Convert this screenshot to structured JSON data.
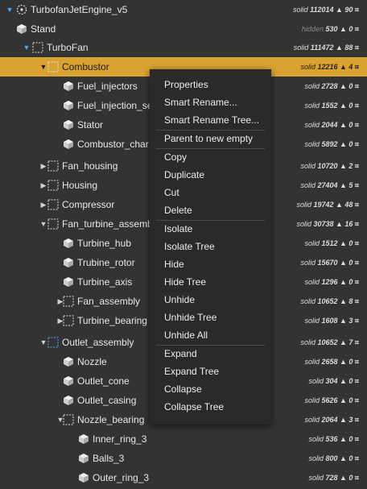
{
  "tree": {
    "rows": [
      {
        "label": "TurbofanJetEngine_v5",
        "icon": "root-icon",
        "toggle": "expanded-blue",
        "status": "solid",
        "count": "112014",
        "tri": "90",
        "selected": false
      },
      {
        "label": "Stand",
        "icon": "part-icon",
        "toggle": "",
        "status": "hidden",
        "count": "530",
        "tri": "0",
        "selected": false
      },
      {
        "label": "TurboFan",
        "icon": "group-icon",
        "toggle": "expanded-blue",
        "status": "solid",
        "count": "111472",
        "tri": "88",
        "selected": false
      },
      {
        "label": "Combustor",
        "icon": "group-icon",
        "toggle": "expanded",
        "status": "solid",
        "count": "12216",
        "tri": "4",
        "selected": true
      },
      {
        "label": "Fuel_injectors",
        "icon": "part-icon",
        "toggle": "",
        "status": "solid",
        "count": "2728",
        "tri": "0",
        "selected": false
      },
      {
        "label": "Fuel_injection_se",
        "icon": "part-icon",
        "toggle": "",
        "status": "solid",
        "count": "1552",
        "tri": "0",
        "selected": false
      },
      {
        "label": "Stator",
        "icon": "part-icon",
        "toggle": "",
        "status": "solid",
        "count": "2044",
        "tri": "0",
        "selected": false
      },
      {
        "label": "Combustor_char",
        "icon": "part-icon",
        "toggle": "",
        "status": "solid",
        "count": "5892",
        "tri": "0",
        "selected": false
      },
      {
        "label": "Fan_housing",
        "icon": "group-icon",
        "toggle": "collapsed",
        "status": "solid",
        "count": "10720",
        "tri": "2",
        "selected": false
      },
      {
        "label": "Housing",
        "icon": "group-icon",
        "toggle": "collapsed",
        "status": "solid",
        "count": "27404",
        "tri": "5",
        "selected": false
      },
      {
        "label": "Compressor",
        "icon": "group-icon",
        "toggle": "collapsed",
        "status": "solid",
        "count": "19742",
        "tri": "48",
        "selected": false
      },
      {
        "label": "Fan_turbine_assemb",
        "icon": "group-icon",
        "toggle": "expanded",
        "status": "solid",
        "count": "30738",
        "tri": "16",
        "selected": false
      },
      {
        "label": "Turbine_hub",
        "icon": "part-icon",
        "toggle": "",
        "status": "solid",
        "count": "1512",
        "tri": "0",
        "selected": false
      },
      {
        "label": "Trubine_rotor",
        "icon": "part-icon",
        "toggle": "",
        "status": "solid",
        "count": "15670",
        "tri": "0",
        "selected": false
      },
      {
        "label": "Turbine_axis",
        "icon": "part-icon",
        "toggle": "",
        "status": "solid",
        "count": "1296",
        "tri": "0",
        "selected": false
      },
      {
        "label": "Fan_assembly",
        "icon": "group-icon",
        "toggle": "collapsed",
        "status": "solid",
        "count": "10652",
        "tri": "8",
        "selected": false
      },
      {
        "label": "Turbine_bearing",
        "icon": "group-icon",
        "toggle": "collapsed",
        "status": "solid",
        "count": "1608",
        "tri": "3",
        "selected": false
      },
      {
        "label": "Outlet_assembly",
        "icon": "group-blue-icon",
        "toggle": "expanded",
        "status": "solid",
        "count": "10652",
        "tri": "7",
        "selected": false
      },
      {
        "label": "Nozzle",
        "icon": "part-icon",
        "toggle": "",
        "status": "solid",
        "count": "2658",
        "tri": "0",
        "selected": false
      },
      {
        "label": "Outlet_cone",
        "icon": "part-icon",
        "toggle": "",
        "status": "solid",
        "count": "304",
        "tri": "0",
        "selected": false
      },
      {
        "label": "Outlet_casing",
        "icon": "part-icon",
        "toggle": "",
        "status": "solid",
        "count": "5626",
        "tri": "0",
        "selected": false
      },
      {
        "label": "Nozzle_bearing",
        "icon": "group-icon",
        "toggle": "expanded",
        "status": "solid",
        "count": "2064",
        "tri": "3",
        "selected": false
      },
      {
        "label": "Inner_ring_3",
        "icon": "part-icon",
        "toggle": "",
        "status": "solid",
        "count": "536",
        "tri": "0",
        "selected": false
      },
      {
        "label": "Balls_3",
        "icon": "part-icon",
        "toggle": "",
        "status": "solid",
        "count": "800",
        "tri": "0",
        "selected": false
      },
      {
        "label": "Outer_ring_3",
        "icon": "part-icon",
        "toggle": "",
        "status": "solid",
        "count": "728",
        "tri": "0",
        "selected": false
      }
    ],
    "tri_glyph": "▲",
    "mark_glyph": "⌗"
  },
  "context_menu": {
    "groups": [
      [
        "Properties",
        "Smart Rename...",
        "Smart Rename Tree..."
      ],
      [
        "Parent to new empty"
      ],
      [
        "Copy",
        "Duplicate",
        "Cut",
        "Delete"
      ],
      [
        "Isolate",
        "Isolate Tree",
        "Hide",
        "Hide Tree",
        "Unhide",
        "Unhide Tree",
        "Unhide All"
      ],
      [
        "Expand",
        "Expand Tree",
        "Collapse",
        "Collapse Tree"
      ]
    ]
  },
  "colors": {
    "background": "#333333",
    "selected_row": "#d9a231",
    "menu_background": "#2a2a2a",
    "accent_blue": "#4aa8ff"
  }
}
